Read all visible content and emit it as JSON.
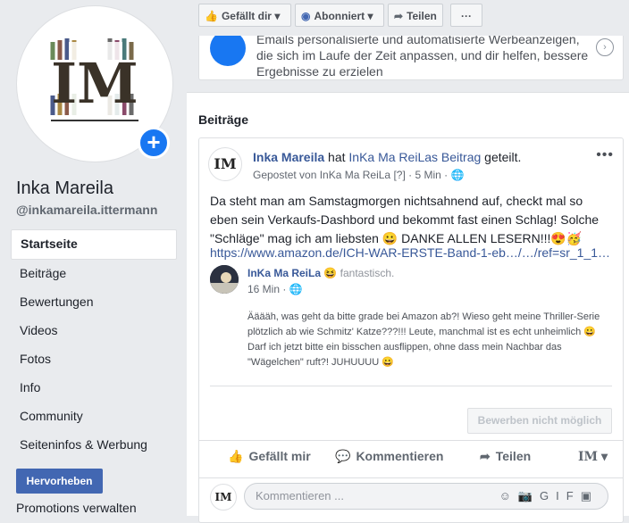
{
  "sidebar": {
    "page_name": "Inka Mareila",
    "handle": "@inkamareila.ittermann",
    "items": [
      {
        "label": "Startseite"
      },
      {
        "label": "Beiträge"
      },
      {
        "label": "Bewertungen"
      },
      {
        "label": "Videos"
      },
      {
        "label": "Fotos"
      },
      {
        "label": "Info"
      },
      {
        "label": "Community"
      },
      {
        "label": "Seiteninfos & Werbung"
      }
    ],
    "promote_button": "Hervorheben",
    "promotions_link": "Promotions verwalten"
  },
  "toolbar": {
    "like_label": "Gefällt dir",
    "follow_label": "Abonniert",
    "share_label": "Teilen",
    "more_label": "···"
  },
  "ad_card": {
    "text": "Emails personalisierte und automatisierte Werbeanzeigen, die sich im Laufe der Zeit anpassen, und dir helfen, bessere Ergebnisse zu erzielen"
  },
  "feed": {
    "title": "Beiträge",
    "post": {
      "author": "Inka Mareila",
      "action_prefix": " hat ",
      "shared_owner": "InKa Ma ReiLas Beitrag",
      "action_suffix": " geteilt.",
      "posted_by": "Gepostet von InKa Ma ReiLa",
      "post_meta": "[?] · 5 Min · 🌐",
      "body": "Da steht man am Samstagmorgen nichtsahnend auf, checkt mal so eben sein Verkaufs-Dashbord und bekommt fast einen Schlag! Solche \"Schläge\" mag ich am liebsten 😀 DANKE ALLEN LESERN!!!😍🥳",
      "link": "https://www.amazon.de/ICH-WAR-ERSTE-Band-1-eb…/…/ref=sr_1_1…",
      "inner": {
        "name": "InKa Ma ReiLa",
        "feeling": " 😆 fantastisch.",
        "time": "16 Min · 🌐",
        "text": "Ääääh, was geht da bitte grade bei Amazon ab?! Wieso geht meine Thriller-Serie plötzlich ab wie Schmitz' Katze???!!! Leute, manchmal ist es echt unheimlich 😀 Darf ich jetzt bitte ein bisschen ausflippen, ohne dass mein Nachbar das \"Wägelchen\" ruft?! JUHUUUU 😀"
      },
      "boost_label": "Bewerben nicht möglich",
      "actions": {
        "like": "Gefällt mir",
        "comment": "Kommentieren",
        "share": "Teilen"
      },
      "comment_placeholder": "Kommentieren ..."
    }
  },
  "logo_text": "IM"
}
